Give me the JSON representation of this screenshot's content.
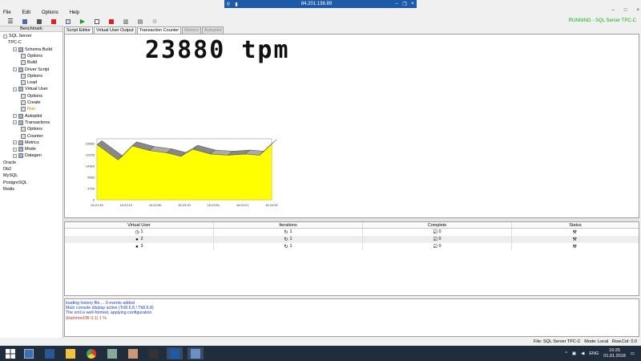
{
  "rdp": {
    "title": "84.201.136.89"
  },
  "menu": {
    "file": "File",
    "edit": "Edit",
    "options": "Options",
    "help": "Help"
  },
  "status_running": "RUNNING - SQL Server TPC-C",
  "tree": {
    "header": "Benchmark",
    "items": [
      {
        "label": "SQL Server",
        "indent": 0
      },
      {
        "label": "TPC-C",
        "indent": 1
      },
      {
        "label": "Schema Build",
        "indent": 2
      },
      {
        "label": "Options",
        "indent": 3
      },
      {
        "label": "Build",
        "indent": 3
      },
      {
        "label": "Driver Script",
        "indent": 2
      },
      {
        "label": "Options",
        "indent": 3
      },
      {
        "label": "Load",
        "indent": 3
      },
      {
        "label": "Virtual User",
        "indent": 2
      },
      {
        "label": "Options",
        "indent": 3
      },
      {
        "label": "Create",
        "indent": 3
      },
      {
        "label": "Run",
        "indent": 3
      },
      {
        "label": "Autopilot",
        "indent": 2
      },
      {
        "label": "Transactions",
        "indent": 2
      },
      {
        "label": "Options",
        "indent": 3
      },
      {
        "label": "Counter",
        "indent": 3
      },
      {
        "label": "Metrics",
        "indent": 2
      },
      {
        "label": "Mode",
        "indent": 2
      },
      {
        "label": "Datagen",
        "indent": 2
      },
      {
        "label": "Oracle",
        "indent": 0
      },
      {
        "label": "Db2",
        "indent": 0
      },
      {
        "label": "MySQL",
        "indent": 0
      },
      {
        "label": "PostgreSQL",
        "indent": 0
      },
      {
        "label": "Redis",
        "indent": 0
      }
    ]
  },
  "tabs": [
    {
      "label": "Script Editor",
      "state": "normal"
    },
    {
      "label": "Virtual User Output",
      "state": "normal"
    },
    {
      "label": "Transaction Counter",
      "state": "active"
    },
    {
      "label": "Metrics",
      "state": "disabled"
    },
    {
      "label": "Autopilot",
      "state": "disabled"
    }
  ],
  "tpm_display": "23880 tpm",
  "chart_data": {
    "type": "area",
    "x": [
      "16:21:49",
      "16:22:19",
      "16:22:50",
      "16:23:20",
      "16:23:51",
      "16:24:21",
      "16:24:52"
    ],
    "y_ticks": [
      0,
      4790,
      9582,
      14369,
      19155,
      23962
    ],
    "ylim": [
      0,
      26000
    ],
    "points": [
      {
        "t": 0.0,
        "v": 23500
      },
      {
        "t": 0.12,
        "v": 17000
      },
      {
        "t": 0.2,
        "v": 23000
      },
      {
        "t": 0.3,
        "v": 21000
      },
      {
        "t": 0.4,
        "v": 20000
      },
      {
        "t": 0.48,
        "v": 18500
      },
      {
        "t": 0.55,
        "v": 21500
      },
      {
        "t": 0.65,
        "v": 19500
      },
      {
        "t": 0.75,
        "v": 19000
      },
      {
        "t": 0.85,
        "v": 19500
      },
      {
        "t": 0.93,
        "v": 19000
      },
      {
        "t": 1.0,
        "v": 23880
      }
    ],
    "fill_color": "#ffff00",
    "ribbon_color": "#888888"
  },
  "vu_table": {
    "headers": [
      "Virtual User",
      "Iterations",
      "Complete",
      "Status"
    ],
    "rows": [
      {
        "user": "1",
        "iterations": "1",
        "complete": "0"
      },
      {
        "user": "2",
        "iterations": "1",
        "complete": "0"
      },
      {
        "user": "3",
        "iterations": "1",
        "complete": "0"
      }
    ]
  },
  "console": [
    {
      "text": "loading history file ... 0 events added",
      "color": "#1a3dcc"
    },
    {
      "text": "Main console display active (Tcl8.6.8 / Tk8.6.8)",
      "color": "#1a3dcc"
    },
    {
      "text": "The xml is well-formed, applying configuration",
      "color": "#1a3dcc"
    },
    {
      "text": "(HammerDB-3.1) 1 %",
      "color": "#c0392b"
    }
  ],
  "statusbar": {
    "file": "File: SQL Server TPC-C",
    "mode": "Mode: Local",
    "rowcol": "Row.Col:  0.0"
  },
  "taskbar": {
    "lang": "ENG",
    "time": "16:25",
    "date": "01.01.2018"
  }
}
